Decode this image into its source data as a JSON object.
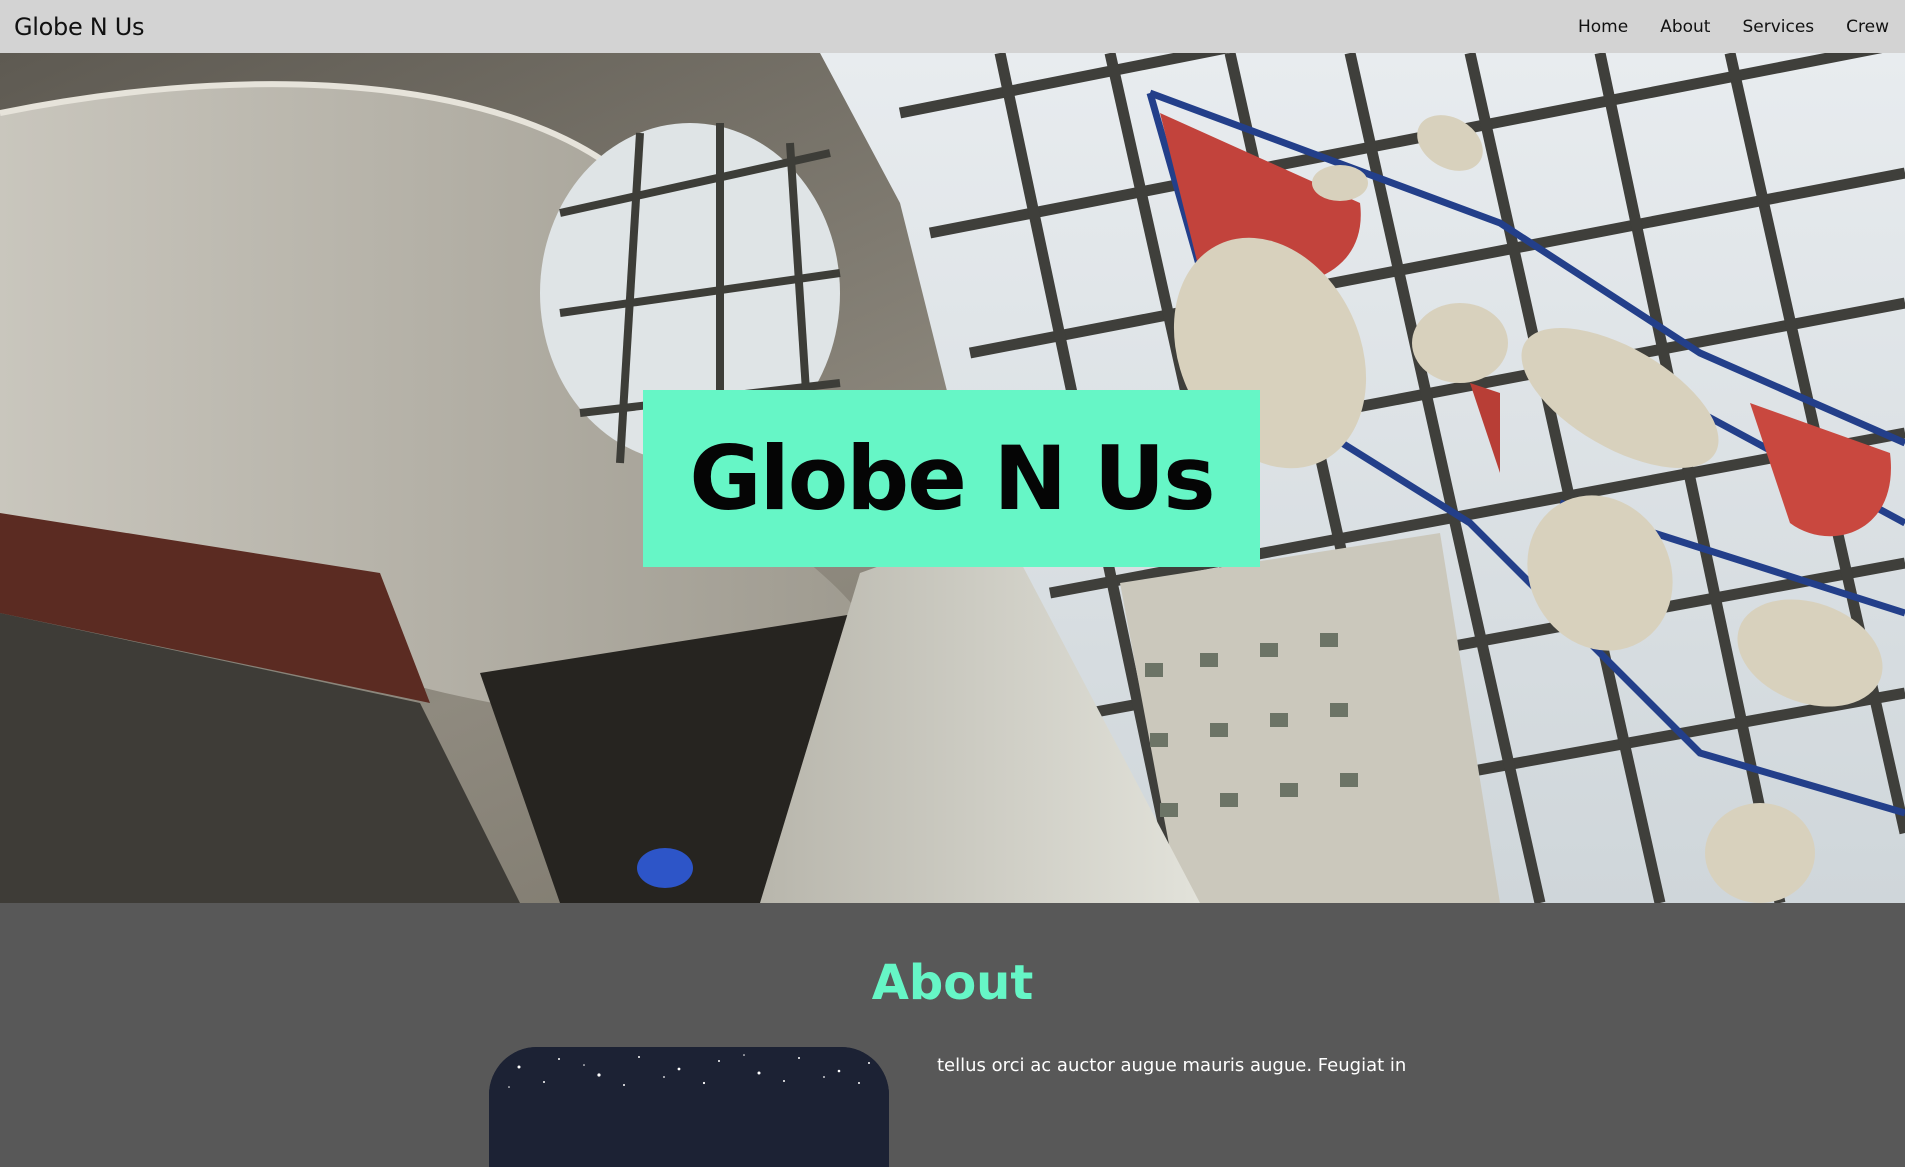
{
  "navbar": {
    "brand": "Globe N Us",
    "links": [
      {
        "label": "Home"
      },
      {
        "label": "About"
      },
      {
        "label": "Services"
      },
      {
        "label": "Crew"
      }
    ]
  },
  "hero": {
    "title": "Globe N Us",
    "title_box_color": "#66f6c6"
  },
  "about": {
    "heading": "About",
    "heading_color": "#66f6c6",
    "text": "tellus orci ac auctor augue mauris augue. Feugiat in",
    "image_icon": "starry-sky-image"
  },
  "colors": {
    "navbar_bg": "#d3d3d3",
    "section_bg": "#585858",
    "accent": "#66f6c6"
  }
}
